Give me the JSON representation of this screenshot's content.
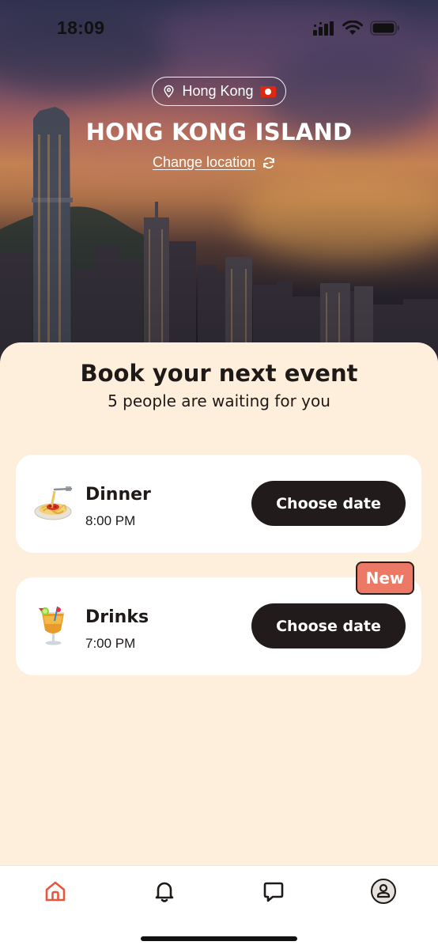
{
  "status_bar": {
    "time": "18:09"
  },
  "location": {
    "city": "Hong Kong",
    "region": "HONG KONG ISLAND",
    "change_label": "Change location"
  },
  "booking": {
    "title": "Book your next event",
    "subtitle": "5 people are waiting for you",
    "events": [
      {
        "name": "Dinner",
        "time": "8:00 PM",
        "icon": "spaghetti-icon",
        "button_label": "Choose date"
      },
      {
        "name": "Drinks",
        "time": "7:00 PM",
        "icon": "tropical-drink-icon",
        "button_label": "Choose date",
        "badge": "New"
      }
    ]
  },
  "tab_bar": {
    "active_tab": "home",
    "tabs": [
      "home-icon",
      "bell-icon",
      "chat-icon",
      "profile-icon"
    ],
    "accent_color": "#e8573b"
  },
  "colors": {
    "background": "#fdefdc",
    "button": "#221b1b",
    "badge": "#ec7866"
  }
}
